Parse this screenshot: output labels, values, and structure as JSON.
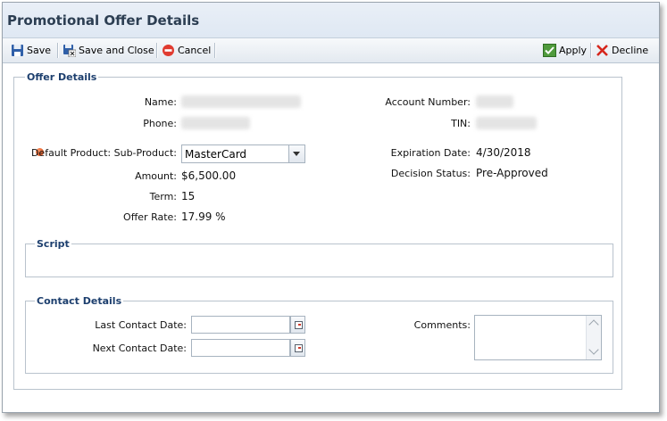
{
  "window": {
    "title": "Promotional Offer Details"
  },
  "toolbar": {
    "save_label": "Save",
    "save_close_label": "Save and Close",
    "cancel_label": "Cancel",
    "apply_label": "Apply",
    "decline_label": "Decline"
  },
  "offer_details": {
    "legend": "Offer Details",
    "name_label": "Name:",
    "phone_label": "Phone:",
    "product_label": "Default Product: Sub-Product:",
    "product_value": "MasterCard",
    "amount_label": "Amount:",
    "amount_value": "$6,500.00",
    "term_label": "Term:",
    "term_value": "15",
    "rate_label": "Offer Rate:",
    "rate_value": "17.99 %",
    "account_label": "Account Number:",
    "tin_label": "TIN:",
    "expiration_label": "Expiration Date:",
    "expiration_value": "4/30/2018",
    "decision_label": "Decision Status:",
    "decision_value": "Pre-Approved"
  },
  "script": {
    "legend": "Script"
  },
  "contact_details": {
    "legend": "Contact Details",
    "last_contact_label": "Last Contact Date:",
    "next_contact_label": "Next Contact Date:",
    "comments_label": "Comments:",
    "last_contact_value": "",
    "next_contact_value": "",
    "comments_value": ""
  },
  "colors": {
    "title_text": "#2c3e52",
    "legend_text": "#1d3f6e",
    "required_marker": "#e2602c"
  }
}
